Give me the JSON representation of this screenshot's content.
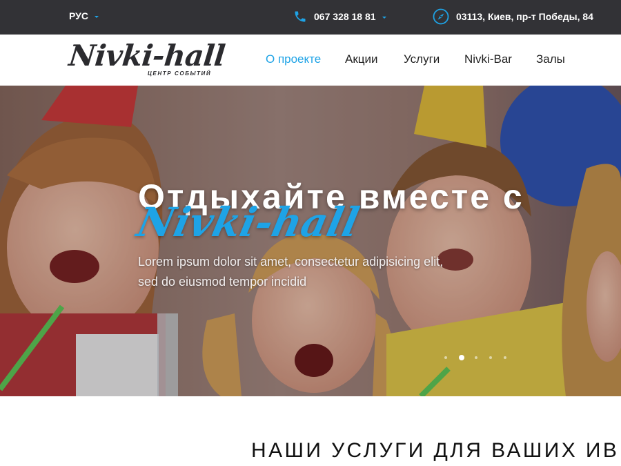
{
  "topbar": {
    "language": "РУС",
    "phone": "067 328 18 81",
    "address": "03113, Киев, пр-т Победы, 84"
  },
  "header": {
    "logo_text": "Nivki-hall",
    "logo_subtitle": "ЦЕНТР СОБЫТИЙ",
    "nav": [
      {
        "label": "О проекте",
        "active": true
      },
      {
        "label": "Акции",
        "active": false
      },
      {
        "label": "Услуги",
        "active": false
      },
      {
        "label": "Nivki-Bar",
        "active": false
      },
      {
        "label": "Залы",
        "active": false
      }
    ]
  },
  "hero": {
    "title": "Отдыхайте вместе с",
    "brand": "Nivki-hall",
    "text": "Lorem ipsum dolor sit amet, consectetur adipisicing elit, sed do eiusmod tempor incidid",
    "slides_total": 5,
    "active_slide": 2
  },
  "services": {
    "title": "НАШИ УСЛУГИ ДЛЯ ВАШИХ ИВ"
  },
  "colors": {
    "accent": "#1ea3e6",
    "topbar_bg": "#323236",
    "dark_text": "#2b2b2f"
  },
  "icons": {
    "phone": "phone-icon",
    "address": "compass-icon",
    "dropdown": "caret-down-icon"
  }
}
